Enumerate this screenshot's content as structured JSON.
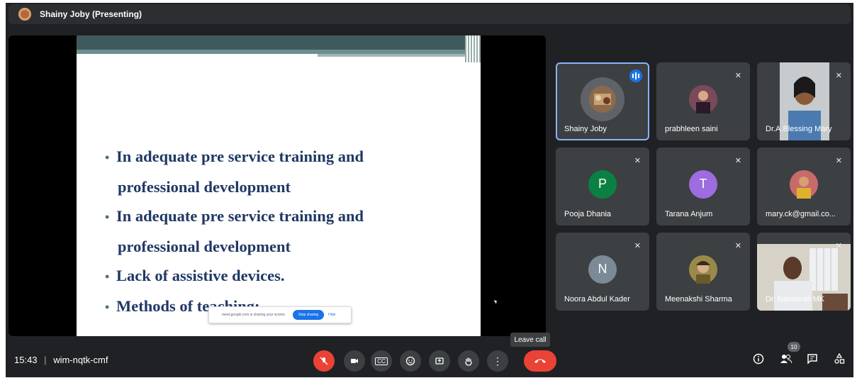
{
  "header": {
    "presenter_title": "Shainy Joby (Presenting)"
  },
  "slide": {
    "bullets": [
      {
        "line1": "In adequate pre service training and",
        "line2": "professional development"
      },
      {
        "line1": "In adequate pre service training and",
        "line2": "professional development"
      },
      {
        "line1": "Lack of assistive devices.",
        "line2": ""
      },
      {
        "line1": "Methods of teaching:",
        "line2": ""
      }
    ],
    "bullet_glyph": "•",
    "share_popup": {
      "message": "meet.google.com is sharing your screen.",
      "stop_label": "Stop sharing",
      "hide_label": "Hide"
    }
  },
  "participants": [
    {
      "name": "Shainy Joby",
      "state": "speaking"
    },
    {
      "name": "prabhleen saini",
      "state": "muted"
    },
    {
      "name": "Dr.A.Blessing Mary",
      "state": "muted"
    },
    {
      "name": "Pooja Dhania",
      "initial": "P",
      "color": "#0b8043",
      "state": "muted"
    },
    {
      "name": "Tarana Anjum",
      "initial": "T",
      "color": "#9c6ce0",
      "state": "muted"
    },
    {
      "name": "mary.ck@gmail.co...",
      "state": "muted"
    },
    {
      "name": "Noora Abdul Kader",
      "initial": "N",
      "color": "#7b8a96",
      "state": "muted"
    },
    {
      "name": "Meenakshi Sharma",
      "state": "muted"
    },
    {
      "name": "Dr. Naseerali MK",
      "state": "muted"
    }
  ],
  "meeting": {
    "time": "15:43",
    "separator": "|",
    "code": "wim-nqtk-cmf"
  },
  "controls": {
    "mic": "mic-off-icon",
    "camera": "camera-icon",
    "captions_label": "CC",
    "emoji": "emoji-icon",
    "present": "present-icon",
    "hand": "hand-icon",
    "more": "more-icon",
    "leave_tooltip": "Leave call"
  },
  "right_controls": {
    "people_count": "10"
  },
  "colors": {
    "accent": "#1a73e8",
    "danger": "#ea4335",
    "surface": "#3c4043",
    "bg": "#202124"
  }
}
